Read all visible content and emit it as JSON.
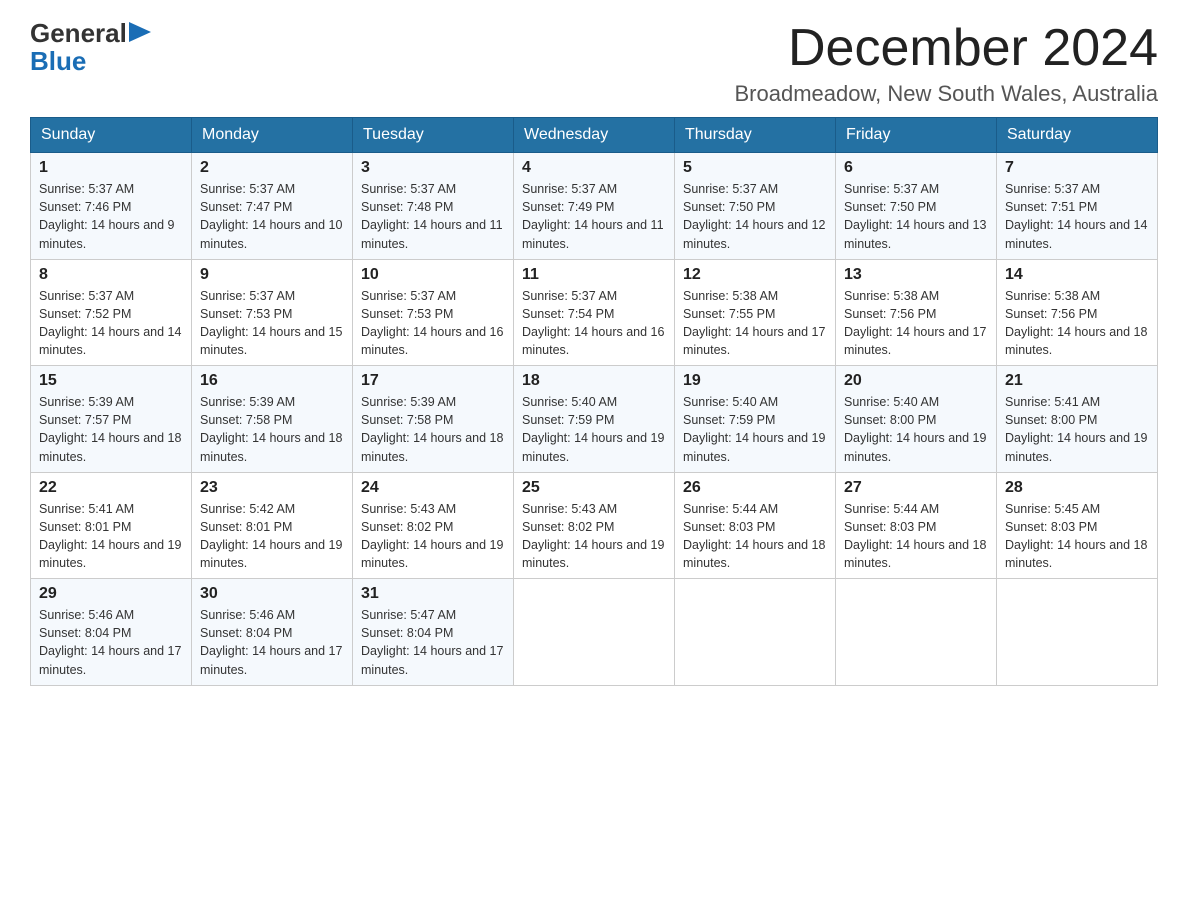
{
  "logo": {
    "part1": "General",
    "triangle": "▶",
    "part2": "Blue"
  },
  "title": "December 2024",
  "location": "Broadmeadow, New South Wales, Australia",
  "weekdays": [
    "Sunday",
    "Monday",
    "Tuesday",
    "Wednesday",
    "Thursday",
    "Friday",
    "Saturday"
  ],
  "weeks": [
    [
      {
        "day": "1",
        "sunrise": "Sunrise: 5:37 AM",
        "sunset": "Sunset: 7:46 PM",
        "daylight": "Daylight: 14 hours and 9 minutes."
      },
      {
        "day": "2",
        "sunrise": "Sunrise: 5:37 AM",
        "sunset": "Sunset: 7:47 PM",
        "daylight": "Daylight: 14 hours and 10 minutes."
      },
      {
        "day": "3",
        "sunrise": "Sunrise: 5:37 AM",
        "sunset": "Sunset: 7:48 PM",
        "daylight": "Daylight: 14 hours and 11 minutes."
      },
      {
        "day": "4",
        "sunrise": "Sunrise: 5:37 AM",
        "sunset": "Sunset: 7:49 PM",
        "daylight": "Daylight: 14 hours and 11 minutes."
      },
      {
        "day": "5",
        "sunrise": "Sunrise: 5:37 AM",
        "sunset": "Sunset: 7:50 PM",
        "daylight": "Daylight: 14 hours and 12 minutes."
      },
      {
        "day": "6",
        "sunrise": "Sunrise: 5:37 AM",
        "sunset": "Sunset: 7:50 PM",
        "daylight": "Daylight: 14 hours and 13 minutes."
      },
      {
        "day": "7",
        "sunrise": "Sunrise: 5:37 AM",
        "sunset": "Sunset: 7:51 PM",
        "daylight": "Daylight: 14 hours and 14 minutes."
      }
    ],
    [
      {
        "day": "8",
        "sunrise": "Sunrise: 5:37 AM",
        "sunset": "Sunset: 7:52 PM",
        "daylight": "Daylight: 14 hours and 14 minutes."
      },
      {
        "day": "9",
        "sunrise": "Sunrise: 5:37 AM",
        "sunset": "Sunset: 7:53 PM",
        "daylight": "Daylight: 14 hours and 15 minutes."
      },
      {
        "day": "10",
        "sunrise": "Sunrise: 5:37 AM",
        "sunset": "Sunset: 7:53 PM",
        "daylight": "Daylight: 14 hours and 16 minutes."
      },
      {
        "day": "11",
        "sunrise": "Sunrise: 5:37 AM",
        "sunset": "Sunset: 7:54 PM",
        "daylight": "Daylight: 14 hours and 16 minutes."
      },
      {
        "day": "12",
        "sunrise": "Sunrise: 5:38 AM",
        "sunset": "Sunset: 7:55 PM",
        "daylight": "Daylight: 14 hours and 17 minutes."
      },
      {
        "day": "13",
        "sunrise": "Sunrise: 5:38 AM",
        "sunset": "Sunset: 7:56 PM",
        "daylight": "Daylight: 14 hours and 17 minutes."
      },
      {
        "day": "14",
        "sunrise": "Sunrise: 5:38 AM",
        "sunset": "Sunset: 7:56 PM",
        "daylight": "Daylight: 14 hours and 18 minutes."
      }
    ],
    [
      {
        "day": "15",
        "sunrise": "Sunrise: 5:39 AM",
        "sunset": "Sunset: 7:57 PM",
        "daylight": "Daylight: 14 hours and 18 minutes."
      },
      {
        "day": "16",
        "sunrise": "Sunrise: 5:39 AM",
        "sunset": "Sunset: 7:58 PM",
        "daylight": "Daylight: 14 hours and 18 minutes."
      },
      {
        "day": "17",
        "sunrise": "Sunrise: 5:39 AM",
        "sunset": "Sunset: 7:58 PM",
        "daylight": "Daylight: 14 hours and 18 minutes."
      },
      {
        "day": "18",
        "sunrise": "Sunrise: 5:40 AM",
        "sunset": "Sunset: 7:59 PM",
        "daylight": "Daylight: 14 hours and 19 minutes."
      },
      {
        "day": "19",
        "sunrise": "Sunrise: 5:40 AM",
        "sunset": "Sunset: 7:59 PM",
        "daylight": "Daylight: 14 hours and 19 minutes."
      },
      {
        "day": "20",
        "sunrise": "Sunrise: 5:40 AM",
        "sunset": "Sunset: 8:00 PM",
        "daylight": "Daylight: 14 hours and 19 minutes."
      },
      {
        "day": "21",
        "sunrise": "Sunrise: 5:41 AM",
        "sunset": "Sunset: 8:00 PM",
        "daylight": "Daylight: 14 hours and 19 minutes."
      }
    ],
    [
      {
        "day": "22",
        "sunrise": "Sunrise: 5:41 AM",
        "sunset": "Sunset: 8:01 PM",
        "daylight": "Daylight: 14 hours and 19 minutes."
      },
      {
        "day": "23",
        "sunrise": "Sunrise: 5:42 AM",
        "sunset": "Sunset: 8:01 PM",
        "daylight": "Daylight: 14 hours and 19 minutes."
      },
      {
        "day": "24",
        "sunrise": "Sunrise: 5:43 AM",
        "sunset": "Sunset: 8:02 PM",
        "daylight": "Daylight: 14 hours and 19 minutes."
      },
      {
        "day": "25",
        "sunrise": "Sunrise: 5:43 AM",
        "sunset": "Sunset: 8:02 PM",
        "daylight": "Daylight: 14 hours and 19 minutes."
      },
      {
        "day": "26",
        "sunrise": "Sunrise: 5:44 AM",
        "sunset": "Sunset: 8:03 PM",
        "daylight": "Daylight: 14 hours and 18 minutes."
      },
      {
        "day": "27",
        "sunrise": "Sunrise: 5:44 AM",
        "sunset": "Sunset: 8:03 PM",
        "daylight": "Daylight: 14 hours and 18 minutes."
      },
      {
        "day": "28",
        "sunrise": "Sunrise: 5:45 AM",
        "sunset": "Sunset: 8:03 PM",
        "daylight": "Daylight: 14 hours and 18 minutes."
      }
    ],
    [
      {
        "day": "29",
        "sunrise": "Sunrise: 5:46 AM",
        "sunset": "Sunset: 8:04 PM",
        "daylight": "Daylight: 14 hours and 17 minutes."
      },
      {
        "day": "30",
        "sunrise": "Sunrise: 5:46 AM",
        "sunset": "Sunset: 8:04 PM",
        "daylight": "Daylight: 14 hours and 17 minutes."
      },
      {
        "day": "31",
        "sunrise": "Sunrise: 5:47 AM",
        "sunset": "Sunset: 8:04 PM",
        "daylight": "Daylight: 14 hours and 17 minutes."
      },
      null,
      null,
      null,
      null
    ]
  ]
}
